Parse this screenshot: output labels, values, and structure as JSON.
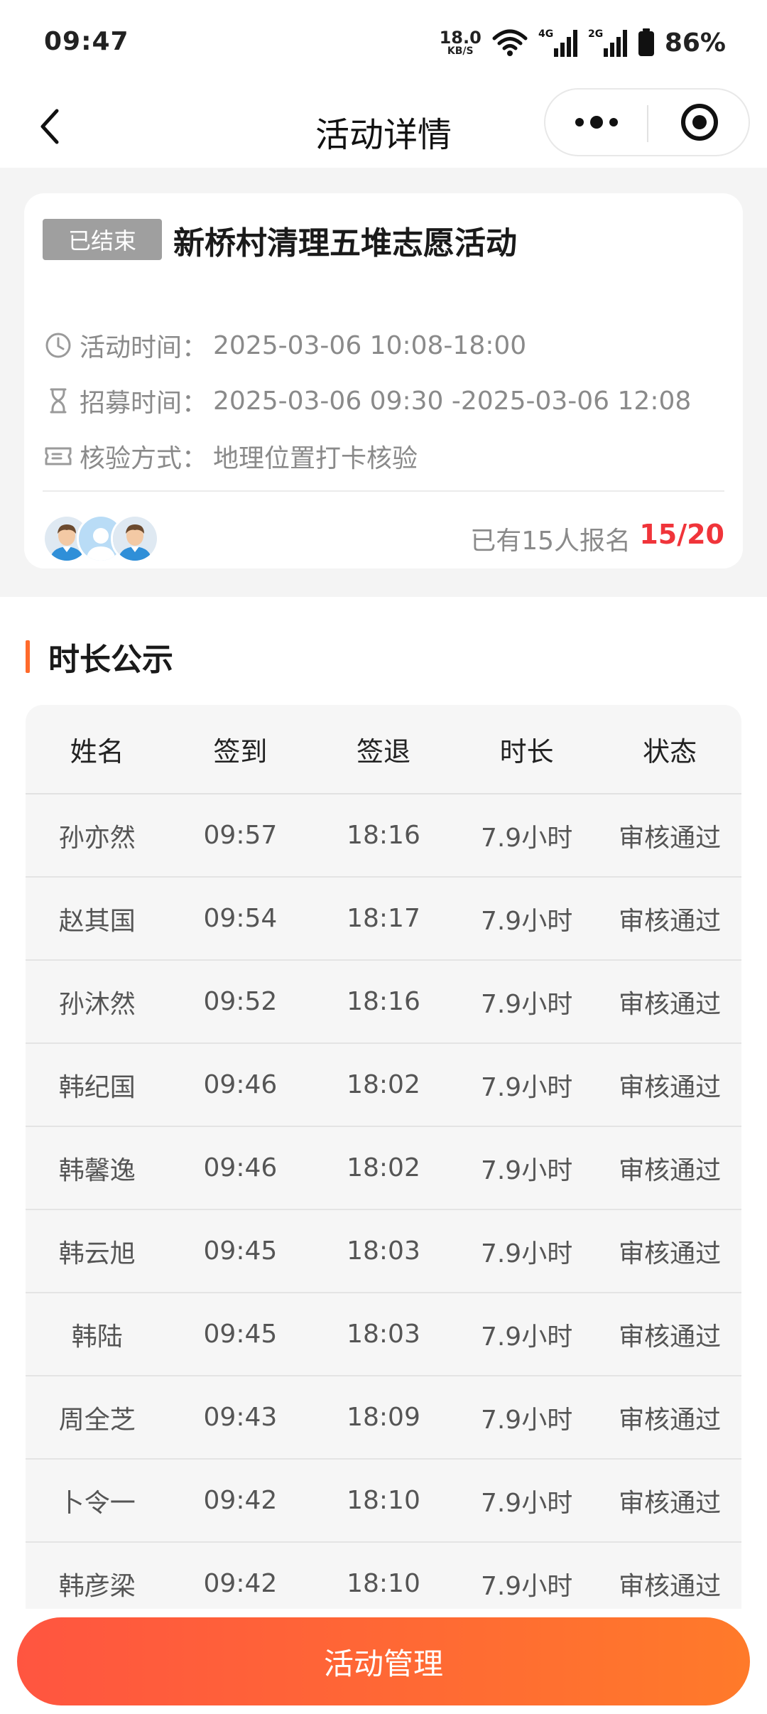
{
  "status_bar": {
    "time": "09:47",
    "net_speed_value": "18.0",
    "net_speed_unit": "KB/S",
    "signal_1_label": "4G",
    "signal_2_label": "2G",
    "battery": "86%"
  },
  "nav": {
    "title": "活动详情"
  },
  "activity": {
    "status": "已结束",
    "title": "新桥村清理五堆志愿活动",
    "activity_time_label": "活动时间：",
    "activity_time": "2025-03-06 10:08-18:00",
    "recruit_time_label": "招募时间：",
    "recruit_time": "2025-03-06 09:30 -2025-03-06 12:08",
    "verify_label": "核验方式：",
    "verify_method": "地理位置打卡核验",
    "signup_text": "已有15人报名",
    "signup_count": "15/20"
  },
  "section": {
    "title": "时长公示"
  },
  "table": {
    "headers": [
      "姓名",
      "签到",
      "签退",
      "时长",
      "状态"
    ],
    "rows": [
      [
        "孙亦然",
        "09:57",
        "18:16",
        "7.9小时",
        "审核通过"
      ],
      [
        "赵其国",
        "09:54",
        "18:17",
        "7.9小时",
        "审核通过"
      ],
      [
        "孙沐然",
        "09:52",
        "18:16",
        "7.9小时",
        "审核通过"
      ],
      [
        "韩纪国",
        "09:46",
        "18:02",
        "7.9小时",
        "审核通过"
      ],
      [
        "韩馨逸",
        "09:46",
        "18:02",
        "7.9小时",
        "审核通过"
      ],
      [
        "韩云旭",
        "09:45",
        "18:03",
        "7.9小时",
        "审核通过"
      ],
      [
        "韩陆",
        "09:45",
        "18:03",
        "7.9小时",
        "审核通过"
      ],
      [
        "周全芝",
        "09:43",
        "18:09",
        "7.9小时",
        "审核通过"
      ],
      [
        "卜令一",
        "09:42",
        "18:10",
        "7.9小时",
        "审核通过"
      ],
      [
        "韩彦梁",
        "09:42",
        "18:10",
        "7.9小时",
        "审核通过"
      ]
    ]
  },
  "bottom": {
    "button_label": "活动管理"
  },
  "colors": {
    "accent": "#ff6a2b",
    "count_red": "#f0343a",
    "badge_gray": "#9f9f9f"
  }
}
